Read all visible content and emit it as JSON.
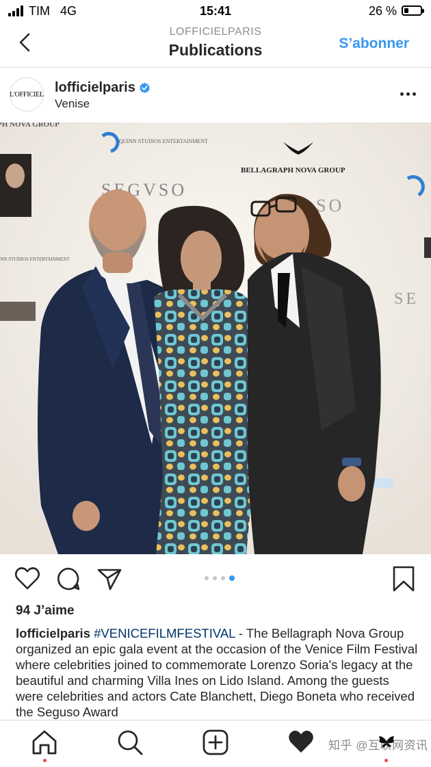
{
  "status_bar": {
    "carrier": "TIM",
    "network": "4G",
    "time": "15:41",
    "battery": "26 %",
    "battery_level": 0.26
  },
  "header": {
    "subtitle": "LOFFICIELPARIS",
    "title": "Publications",
    "subscribe_label": "S’abonner"
  },
  "post": {
    "avatar_text": "L'OFFICIEL",
    "username": "lofficielparis",
    "location": "Venise",
    "carousel": {
      "count": 4,
      "active_index": 3
    },
    "likes": "94 J’aime",
    "caption": {
      "username": "lofficielparis",
      "hashtag": "#VENICEFILMFESTIVAL",
      "text": " - The Bellagraph Nova Group organized an epic gala event at the occasion of the Venice Film Festival where celebrities joined to commemorate Lorenzo Soria's legacy at the beautiful and charming Villa Ines on Lido Island. Among the guests were celebrities and actors Cate Blanchett, Diego Boneta who received the Seguso Award"
    }
  },
  "backdrop": {
    "logos": [
      "PH NOVA GROUP",
      "QUINN STUDIOS ENTERTAINMENT",
      "BELLAGRAPH NOVA GROUP",
      "SEGVSO",
      "SO",
      "SE",
      "INN STUDIOS ENTERTAINMENT"
    ]
  },
  "nav": {
    "watermark": "知乎 @互联网资讯"
  },
  "colors": {
    "accent": "#3897f0",
    "verified": "#3897f0",
    "notification": "#ed4956"
  },
  "icons": [
    "back-chevron-icon",
    "verified-icon",
    "more-icon",
    "heart-icon",
    "comment-icon",
    "share-icon",
    "bookmark-icon",
    "home-icon",
    "search-icon",
    "add-icon",
    "activity-heart-icon",
    "profile-icon"
  ]
}
